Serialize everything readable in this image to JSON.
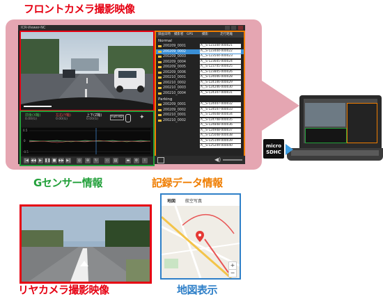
{
  "labels": {
    "front_camera": "フロントカメラ撮影映像",
    "g_sensor": "Gセンサー情報",
    "recording_data": "記録データ情報",
    "rear_camera": "リヤカメラ撮影映像",
    "map_display": "地図表示"
  },
  "app": {
    "title": "ICR-Viewer-NC",
    "list_header": [
      "録画日時",
      "撮影者",
      "GPS",
      "撮影",
      "走行距離"
    ],
    "section_normal": "Normal",
    "section_parking": "Parking",
    "normal_rows": [
      {
        "name": "200209_0001",
        "value": "A__S-123344-000021"
      },
      {
        "name": "200209_0002",
        "value": "A__S-123444-000022",
        "selected": true
      },
      {
        "name": "200209_0003",
        "value": "A__S-123544-000023"
      },
      {
        "name": "200209_0004",
        "value": "A__S-123645-000024"
      },
      {
        "name": "200209_0005",
        "value": "A__S-123745-000025"
      },
      {
        "name": "200209_0006",
        "value": "A__S-123845-000026"
      },
      {
        "name": "200210_0001",
        "value": "A__S-124046-000028"
      },
      {
        "name": "200210_0002",
        "value": "A__S-124146-000029"
      },
      {
        "name": "200210_0003",
        "value": "A__S-124246-000030"
      },
      {
        "name": "200210_0004",
        "value": "A__S-124347-000031"
      }
    ],
    "parking_rows": [
      {
        "name": "200209_0001",
        "value": "A__S-124447-000032"
      },
      {
        "name": "200209_0002",
        "value": "A__S-124547-000033"
      },
      {
        "name": "200210_0001",
        "value": "A__S-124648-000034"
      },
      {
        "name": "200210_0002",
        "value": "A__S-124748-000035"
      },
      {
        "name": "",
        "value": "A__S-124848-000036"
      },
      {
        "name": "",
        "value": "A__S-124948-000037"
      },
      {
        "name": "",
        "value": "A__S-125048-000038"
      },
      {
        "name": "",
        "value": "A__S-125149-000039"
      },
      {
        "name": "",
        "value": "A__S-125249-000040"
      }
    ],
    "gsensor": {
      "front_back": {
        "label": "前後(X軸)",
        "value": "0.00(G)"
      },
      "left_right": {
        "label": "左右(Y軸)",
        "value": "0.00(G)"
      },
      "up_down": {
        "label": "上下(Z軸)",
        "value": "0.00(G)"
      },
      "badge": "Full HD",
      "ytick_top": "0.5",
      "ytick_mid": "0",
      "ytick_bottom": "-0.5"
    }
  },
  "sd_card": {
    "line1": "micro",
    "line2": "SDHC"
  },
  "map": {
    "tab_map": "地図",
    "tab_aerial": "航空写真",
    "zoom_in": "+",
    "zoom_out": "−"
  },
  "colors": {
    "red": "#e60012",
    "green": "#22a03a",
    "orange": "#ef7d00",
    "blue": "#2e7fc8",
    "callout": "#e5a6b2"
  }
}
